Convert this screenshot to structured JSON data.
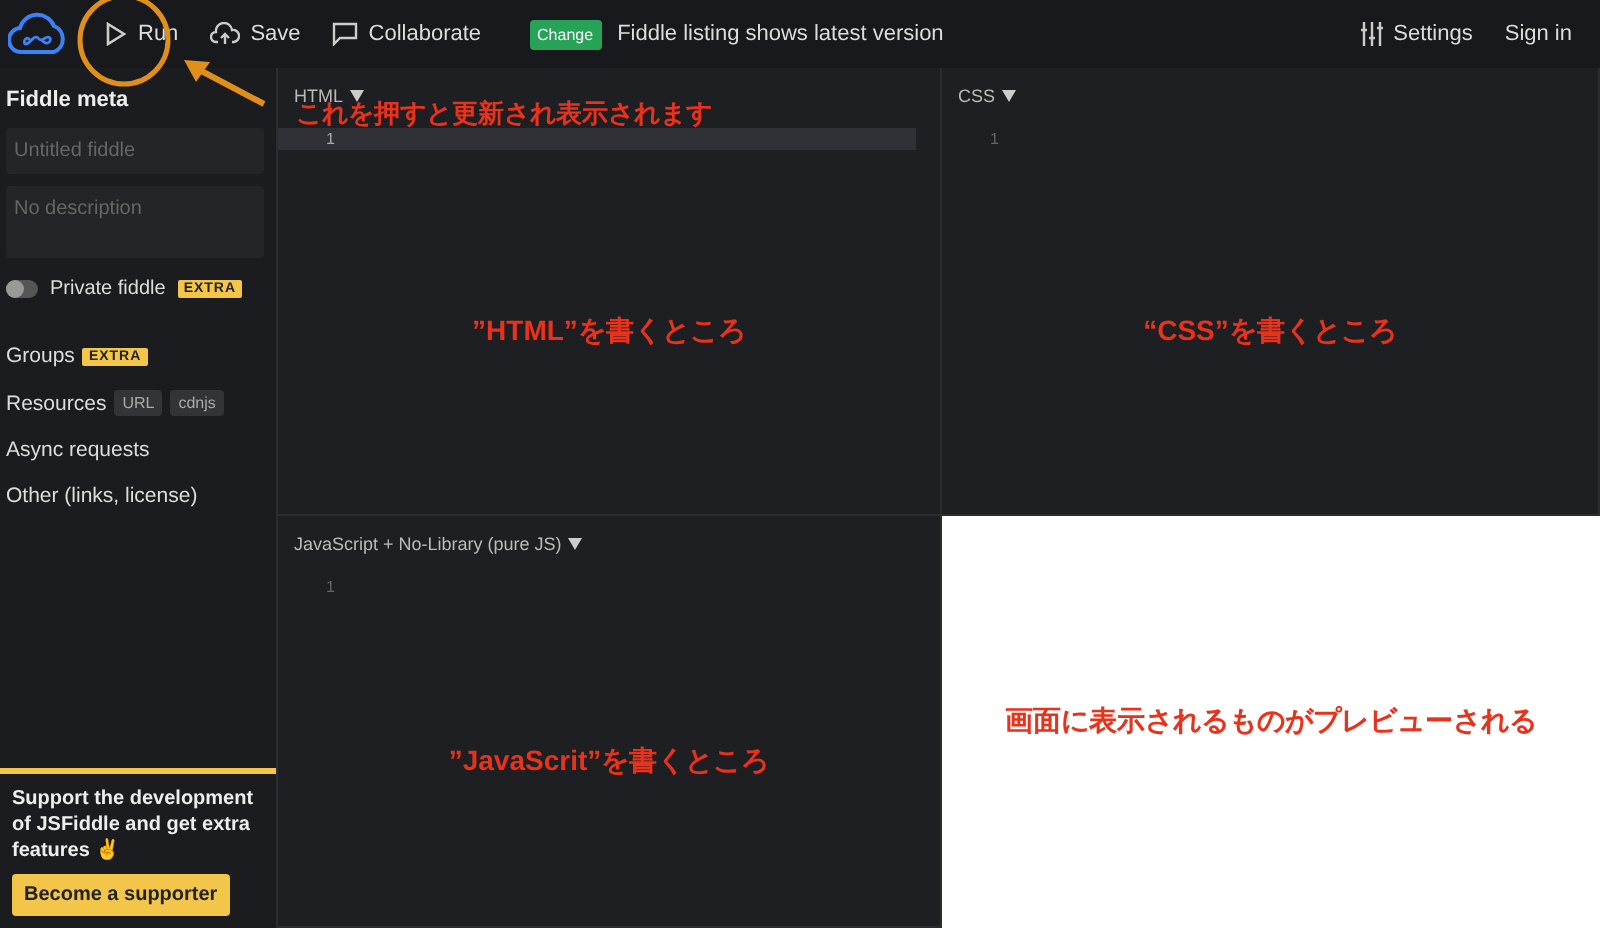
{
  "toolbar": {
    "buttons": [
      {
        "kind": "run",
        "label": "Run"
      },
      {
        "kind": "save",
        "label": "Save"
      },
      {
        "kind": "collaborate",
        "label": "Collaborate"
      }
    ],
    "badge": "Change",
    "status": "Fiddle listing shows latest version",
    "right": [
      {
        "kind": "settings",
        "label": "Settings"
      },
      {
        "kind": "signin",
        "label": "Sign in"
      }
    ]
  },
  "sidebar": {
    "title": "Fiddle meta",
    "title_field": {
      "placeholder": "Untitled fiddle"
    },
    "description_field": {
      "placeholder": "No description"
    },
    "private": {
      "label": "Private fiddle",
      "on": false,
      "tag": "EXTRA"
    },
    "items": [
      {
        "label": "Groups",
        "tags": [
          {
            "kind": "extra",
            "text": "EXTRA"
          }
        ]
      },
      {
        "label": "Resources",
        "tags": [
          {
            "kind": "plain",
            "text": "URL"
          },
          {
            "kind": "plain",
            "text": "cdnjs"
          }
        ]
      },
      {
        "label": "Async requests"
      },
      {
        "label": "Other (links, license)"
      }
    ],
    "support": {
      "text": "Support the development of JSFiddle and get extra features ✌",
      "button": "Become a supporter"
    }
  },
  "panels": [
    {
      "kind": "editor",
      "title": "HTML",
      "line": "1",
      "active_line": true,
      "note": "”HTML”を書くところ"
    },
    {
      "kind": "editor",
      "title": "CSS",
      "line": "1",
      "active_line": false,
      "note": "“CSS”を書くところ"
    },
    {
      "kind": "editor",
      "title": "JavaScript + No-Library (pure JS)",
      "line": "1",
      "active_line": false,
      "note": "”JavaScrit”を書くところ"
    },
    {
      "kind": "preview",
      "note": "画面に表示されるものがプレビューされる"
    }
  ],
  "run_note": "これを押すと更新され表示されます"
}
